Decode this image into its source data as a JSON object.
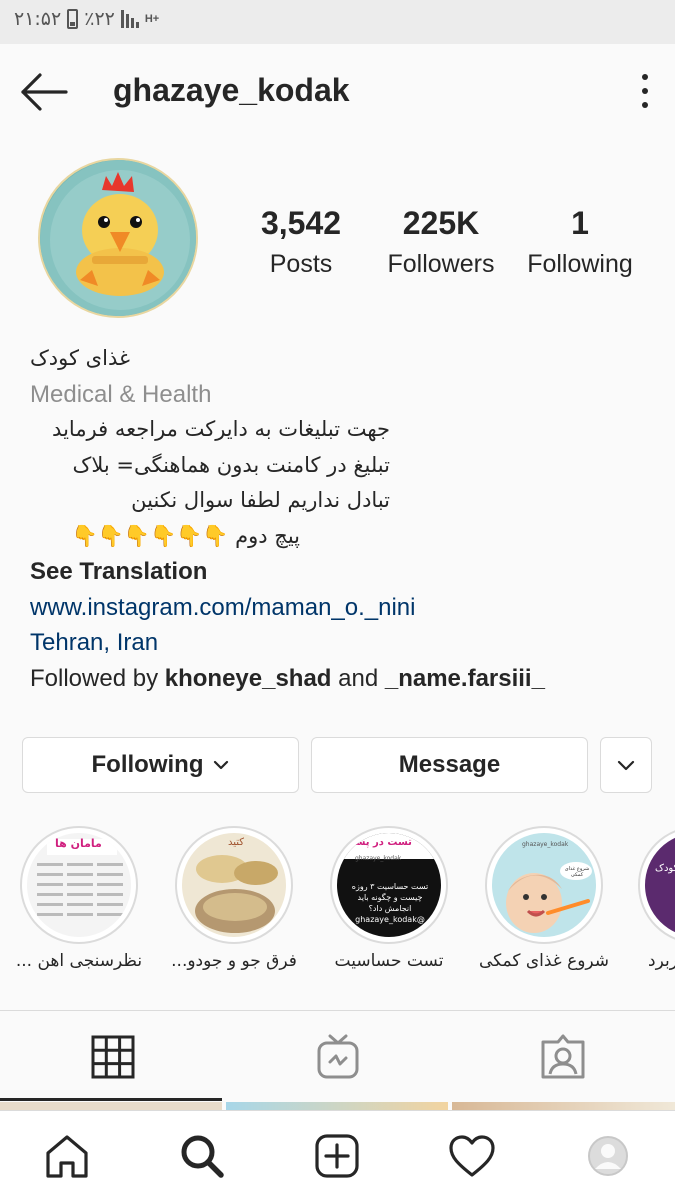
{
  "status_bar": {
    "time": "۲۱:۵۲",
    "battery": "٪۲۲",
    "network": "H+"
  },
  "header": {
    "username": "ghazaye_kodak"
  },
  "stats": [
    {
      "value": "3,542",
      "label": "Posts"
    },
    {
      "value": "225K",
      "label": "Followers"
    },
    {
      "value": "1",
      "label": "Following"
    }
  ],
  "bio": {
    "name": "غذای کودک",
    "category": "Medical & Health",
    "lines": [
      "جهت تبلیغات به دایرکت مراجعه فرماید",
      "تبلیغ در کامنت بدون هماهنگی= بلاک",
      "تبادل نداریم لطفا سوال نکنین",
      "پیچ دوم 👇👇👇👇👇👇"
    ],
    "see_translation": "See Translation",
    "website": "www.instagram.com/maman_o._nini",
    "location": "Tehran, Iran",
    "followed_by_prefix": "Followed by ",
    "followed_by_user1": "khoneye_shad",
    "followed_by_and": " and ",
    "followed_by_user2": "_name.farsiii_"
  },
  "actions": {
    "following": "Following",
    "message": "Message"
  },
  "highlights": [
    {
      "label": "نظرسنجی اهن ...",
      "image_text": "مامان ها"
    },
    {
      "label": "فرق جو و جودو...",
      "image_text": "کتید"
    },
    {
      "label": "تست حساسیت",
      "image_text": "تست حساسیت ۳ روزه چیست و چگونه باید انجامش داد؟ @ghazaye_kodak",
      "image_header": "تست در پست",
      "image_watermark": "ghazaye_kodak"
    },
    {
      "label": "شروع غذای کمکی",
      "image_text": "شروع غذای کمکی",
      "image_watermark": "ghazaye_kodak"
    },
    {
      "label": "کاربرد",
      "image_text": "کودک"
    }
  ],
  "colors": {
    "link": "#003569",
    "category": "#8e8e8e",
    "border": "#dbdbdb",
    "text": "#262626"
  }
}
